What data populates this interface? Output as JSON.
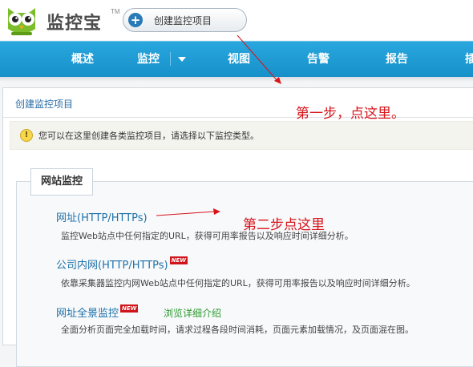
{
  "header": {
    "brand": "监控宝",
    "trademark": "TM",
    "create_button": "创建监控项目"
  },
  "nav": {
    "items": [
      "概述",
      "监控",
      "视图",
      "告警",
      "报告",
      "插"
    ]
  },
  "panel": {
    "title": "创建监控项目",
    "tip": "您可以在这里创建各类监控项目，请选择以下监控类型。",
    "group_title": "网站监控",
    "items": [
      {
        "title": "网址(HTTP/HTTPs)",
        "desc": "监控Web站点中任何指定的URL，获得可用率报告以及响应时间详细分析。"
      },
      {
        "title": "公司内网(HTTP/HTTPs)",
        "badge": "NEW",
        "desc": "依靠采集器监控内网Web站点中任何指定的URL，获得可用率报告以及响应时间详细分析。"
      },
      {
        "title": "网址全景监控",
        "badge": "NEW",
        "link": "浏览详细介绍",
        "desc": "全面分析页面完全加载时间，请求过程各段时间消耗，页面元素加载情况，及页面混在图。"
      }
    ]
  },
  "annotations": {
    "step1": "第一步，点这里。",
    "step2": "第二步点这里",
    "color": "#d8141b"
  }
}
